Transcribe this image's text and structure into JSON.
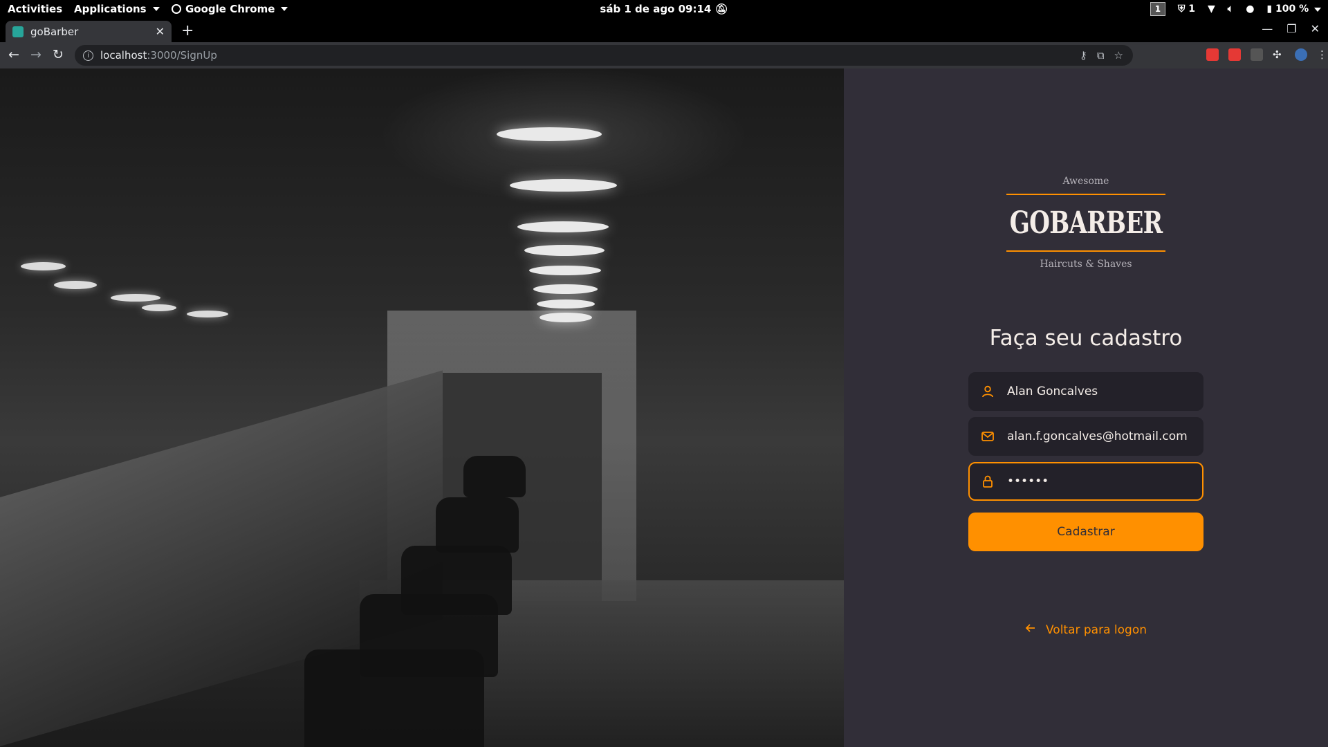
{
  "os_topbar": {
    "activities": "Activities",
    "applications": "Applications",
    "app_name": "Google Chrome",
    "clock": "sáb 1 de ago  09:14",
    "workspace": "1",
    "shield_count": "1",
    "battery": "100 %"
  },
  "browser": {
    "tab_title": "goBarber",
    "url_host": "localhost",
    "url_path": ":3000/SignUp"
  },
  "logo": {
    "top": "Awesome",
    "brand": "GOBARBER",
    "bottom": "Haircuts & Shaves"
  },
  "form": {
    "title": "Faça seu cadastro",
    "name_value": "Alan Goncalves",
    "email_value": "alan.f.goncalves@hotmail.com",
    "password_value": "••••••",
    "submit_label": "Cadastrar",
    "back_label": "Voltar para logon"
  },
  "colors": {
    "accent": "#ff9000",
    "background": "#312e38",
    "input_bg": "#232129",
    "text": "#f4ede8"
  }
}
